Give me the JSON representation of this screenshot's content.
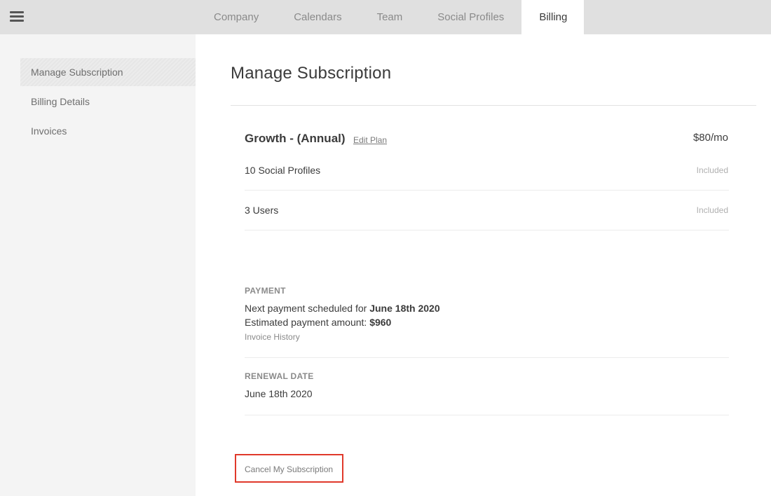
{
  "topbar": {
    "menu_icon": "hamburger-menu-icon",
    "tabs": [
      {
        "label": "Company"
      },
      {
        "label": "Calendars"
      },
      {
        "label": "Team"
      },
      {
        "label": "Social Profiles"
      },
      {
        "label": "Billing",
        "active": true
      }
    ]
  },
  "sidebar": {
    "items": [
      {
        "label": "Manage Subscription",
        "active": true
      },
      {
        "label": "Billing Details"
      },
      {
        "label": "Invoices"
      }
    ]
  },
  "main": {
    "title": "Manage Subscription",
    "plan": {
      "name": "Growth - (Annual)",
      "edit_label": "Edit Plan",
      "price": "$80/mo"
    },
    "features": [
      {
        "label": "10 Social Profiles",
        "status": "Included"
      },
      {
        "label": "3 Users",
        "status": "Included"
      }
    ],
    "payment": {
      "heading": "PAYMENT",
      "next_prefix": "Next payment scheduled for ",
      "next_date": "June 18th 2020",
      "amount_prefix": "Estimated payment amount: ",
      "amount": "$960",
      "history_link": "Invoice History"
    },
    "renewal": {
      "heading": "RENEWAL DATE",
      "date": "June 18th 2020"
    },
    "cancel_label": "Cancel My Subscription",
    "highlight_color": "#e0392b"
  }
}
